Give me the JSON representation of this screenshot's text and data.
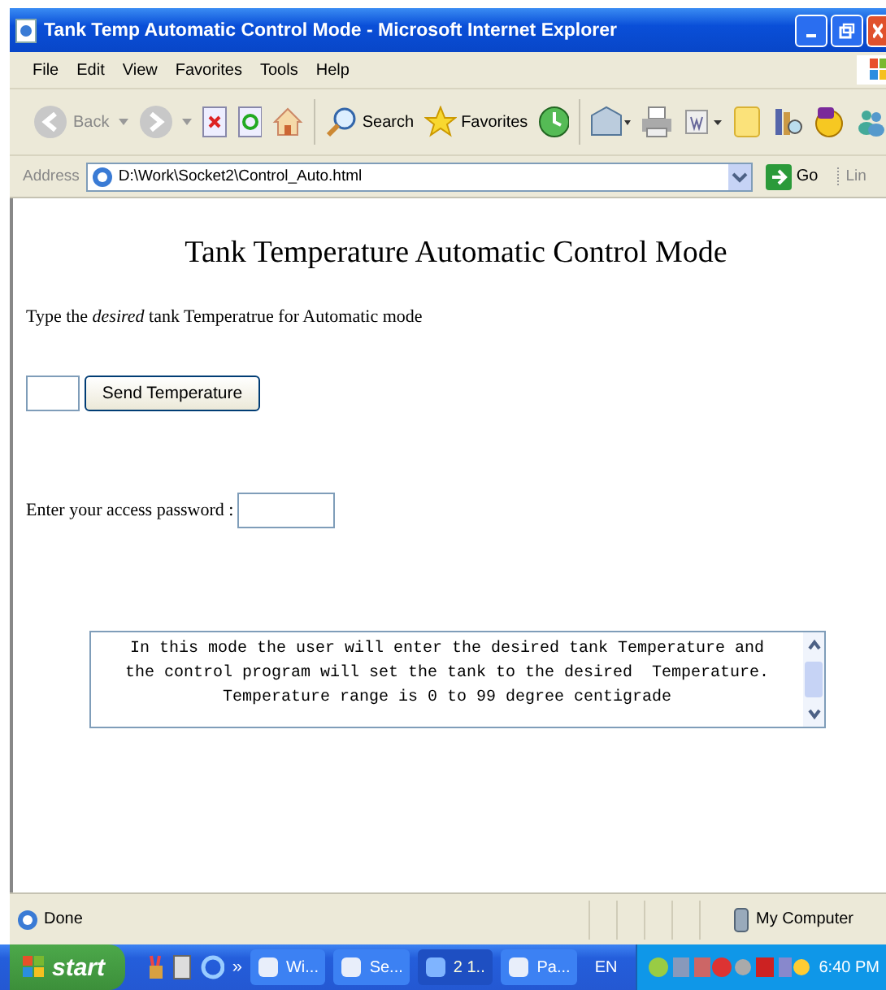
{
  "window": {
    "title": "Tank Temp Automatic Control Mode - Microsoft Internet Explorer"
  },
  "menu": [
    "File",
    "Edit",
    "View",
    "Favorites",
    "Tools",
    "Help"
  ],
  "toolbar": {
    "back": "Back",
    "search": "Search",
    "favorites": "Favorites"
  },
  "address": {
    "label": "Address",
    "value": "D:\\Work\\Socket2\\Control_Auto.html",
    "go": "Go",
    "links": "Lin"
  },
  "page": {
    "heading": "Tank Temperature Automatic Control Mode",
    "instruction": "Type the *desired* tank Temperatrue for Automatic mode",
    "send_button": "Send Temperature",
    "password_label": "Enter your access password :",
    "info_lines": [
      "In this mode the user will enter the desired tank Temperature and",
      "the control program will set the tank to the desired  Temperature.",
      "Temperature range is 0 to 99 degree centigrade"
    ]
  },
  "status_bar": {
    "status": "Done",
    "zone": "My Computer"
  },
  "taskbar": {
    "start": "start",
    "more": "»",
    "tasks": [
      {
        "label": "Wi...",
        "selected": false
      },
      {
        "label": "Se...",
        "selected": false
      },
      {
        "label": "2 1..",
        "selected": true
      },
      {
        "label": "Pa...",
        "selected": false
      }
    ],
    "language": "EN",
    "clock": "6:40 PM"
  }
}
